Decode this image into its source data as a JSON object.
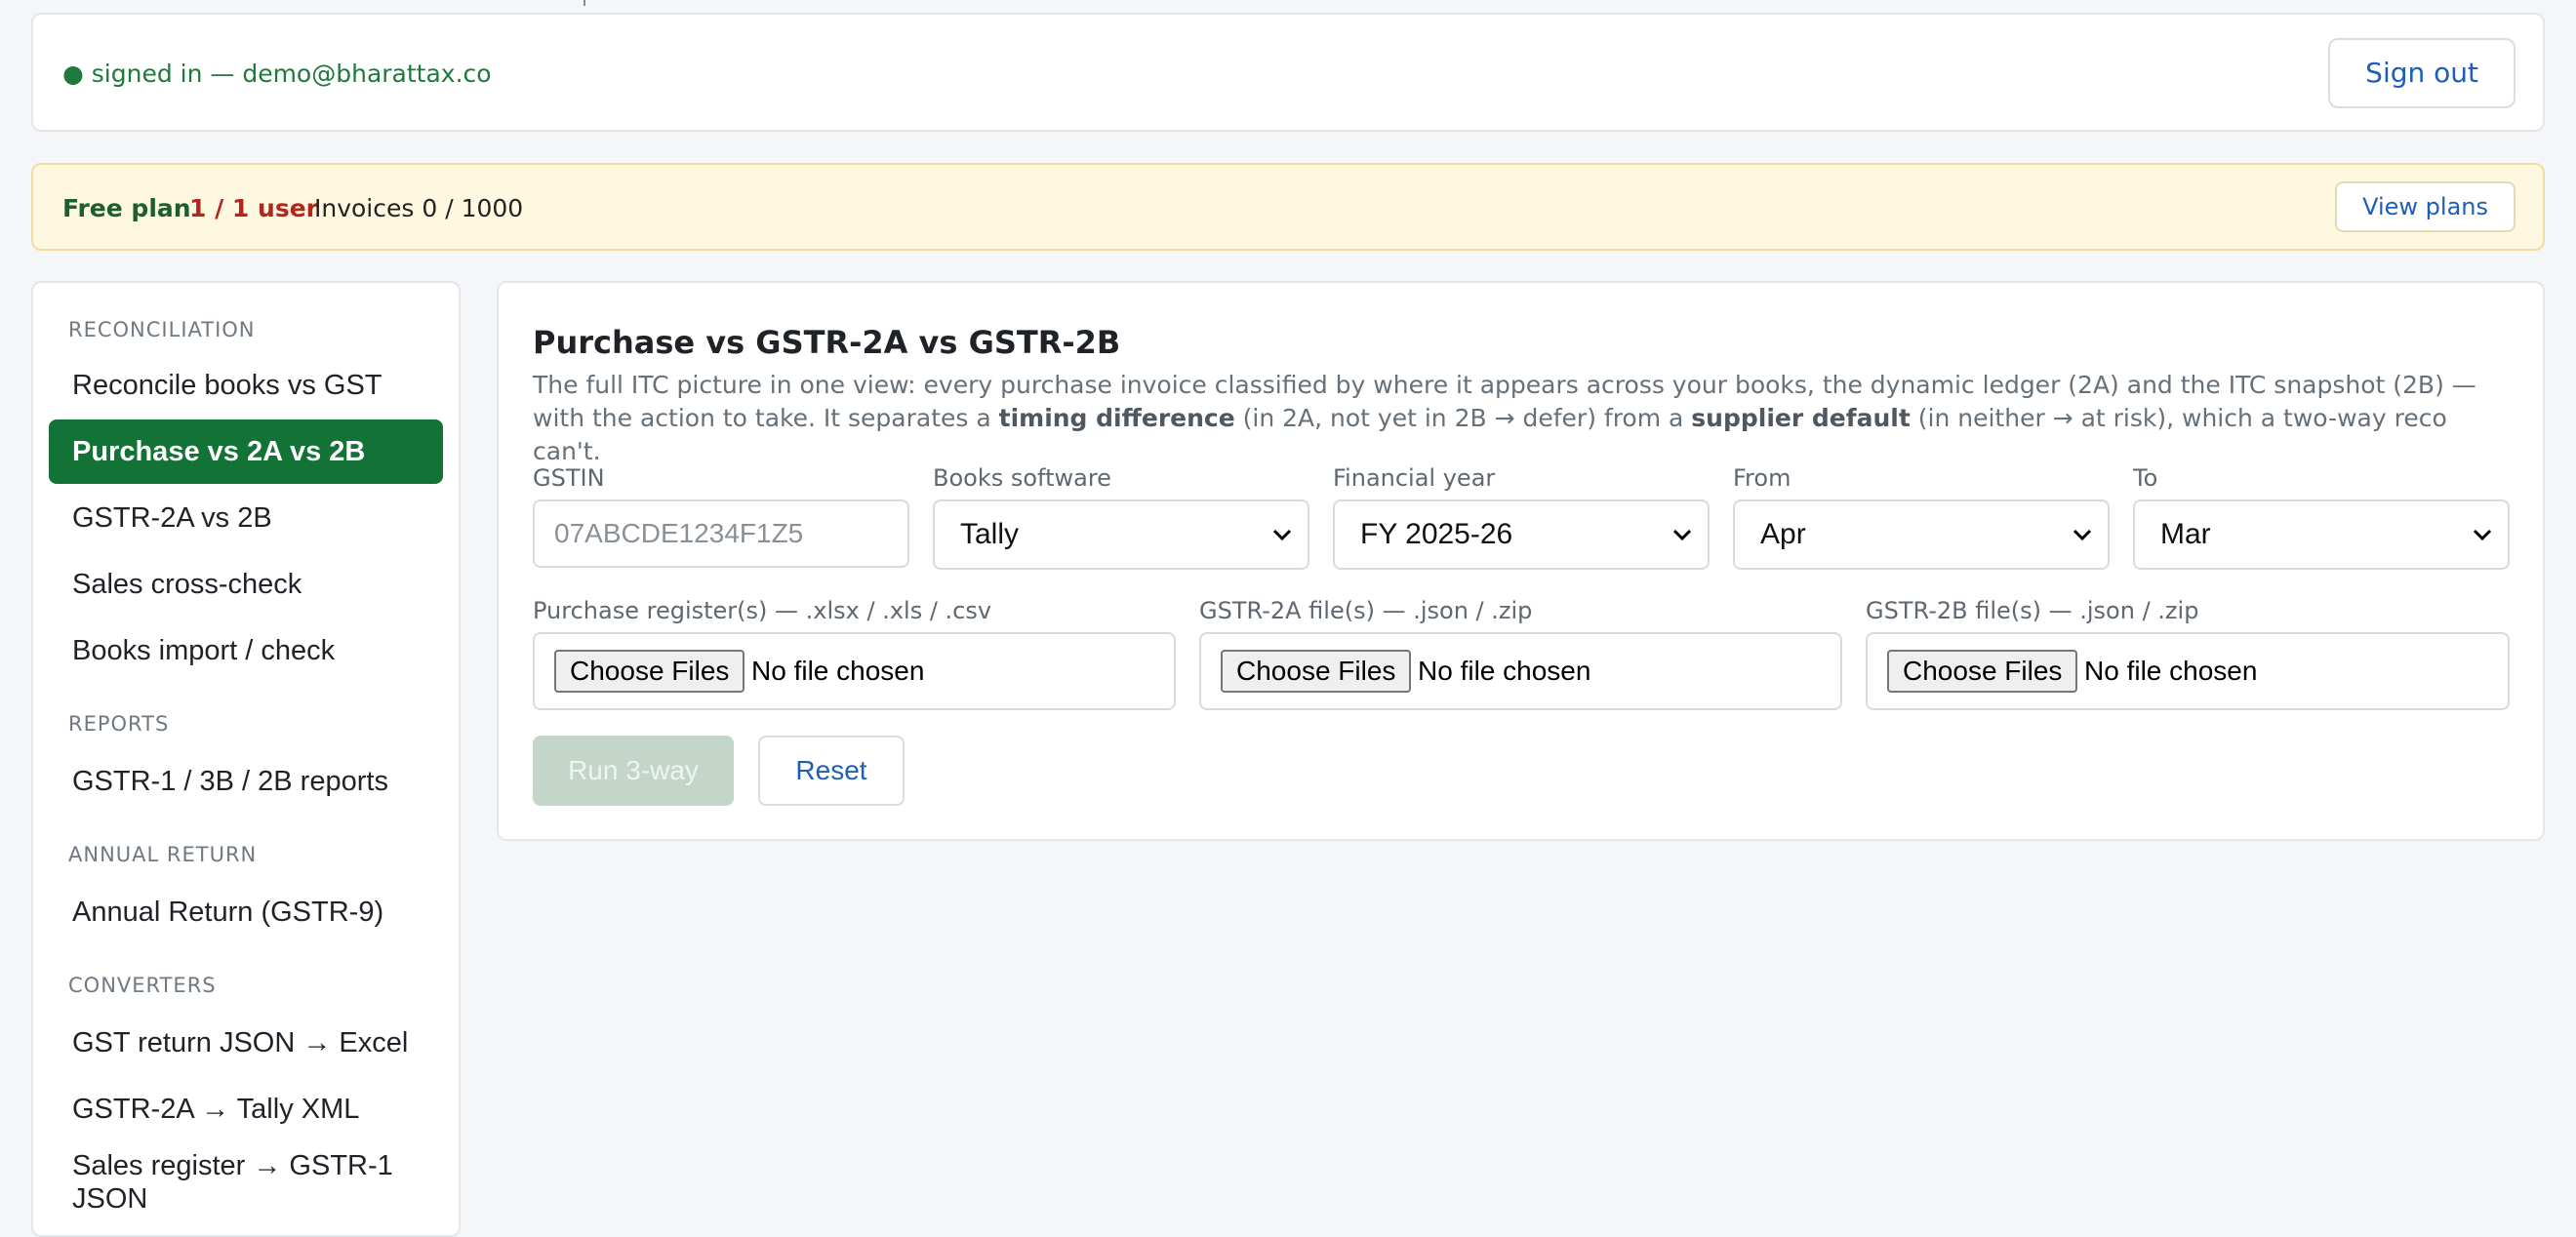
{
  "header": {
    "signed_in_text": "● signed in — demo@bharattax.co",
    "sign_out_label": "Sign out"
  },
  "plan": {
    "name": "Free plan",
    "users": "1 / 1 user",
    "invoices": "Invoices 0 / 1000",
    "view_plans_label": "View plans"
  },
  "sidebar": {
    "sections": [
      {
        "title": "RECONCILIATION"
      },
      {
        "title": "REPORTS"
      },
      {
        "title": "ANNUAL RETURN"
      },
      {
        "title": "CONVERTERS"
      }
    ],
    "items": [
      {
        "label": "Reconcile books vs GST"
      },
      {
        "label": "Purchase vs 2A vs 2B",
        "active": true
      },
      {
        "label": "GSTR-2A vs 2B"
      },
      {
        "label": "Sales cross-check"
      },
      {
        "label": "Books import / check"
      },
      {
        "label": "GSTR-1 / 3B / 2B reports"
      },
      {
        "label": "Annual Return (GSTR-9)"
      },
      {
        "label": "GST return JSON → Excel"
      },
      {
        "label": "GSTR-2A → Tally XML"
      },
      {
        "label": "Sales register → GSTR-1 JSON"
      }
    ]
  },
  "main": {
    "title": "Purchase vs GSTR-2A vs GSTR-2B",
    "desc_1": "The full ITC picture in one view: every purchase invoice classified by where it appears across your books, the dynamic ledger (2A) and the ITC snapshot (2B) — with the action to take. It separates a ",
    "desc_bold_1": "timing difference",
    "desc_2": " (in 2A, not yet in 2B → defer) from a ",
    "desc_bold_2": "supplier default",
    "desc_3": " (in neither → at risk), which a two-way reco can't.",
    "fields": {
      "gstin_label": "GSTIN",
      "gstin_placeholder": "07ABCDE1234F1Z5",
      "books_label": "Books software",
      "books_value": "Tally",
      "fy_label": "Financial year",
      "fy_value": "FY 2025-26",
      "from_label": "From",
      "from_value": "Apr",
      "to_label": "To",
      "to_value": "Mar"
    },
    "uploads": [
      {
        "label": "Purchase register(s) — .xlsx / .xls / .csv",
        "button": "Choose Files",
        "status": "No file chosen"
      },
      {
        "label": "GSTR-2A file(s) — .json / .zip",
        "button": "Choose Files",
        "status": "No file chosen"
      },
      {
        "label": "GSTR-2B file(s) — .json / .zip",
        "button": "Choose Files",
        "status": "No file chosen"
      }
    ],
    "run_label": "Run 3-way",
    "reset_label": "Reset"
  },
  "colors": {
    "accent_green": "#137235",
    "link_blue": "#1d5fb8",
    "plan_bg": "#fff8e1",
    "danger_red": "#b3261e"
  }
}
